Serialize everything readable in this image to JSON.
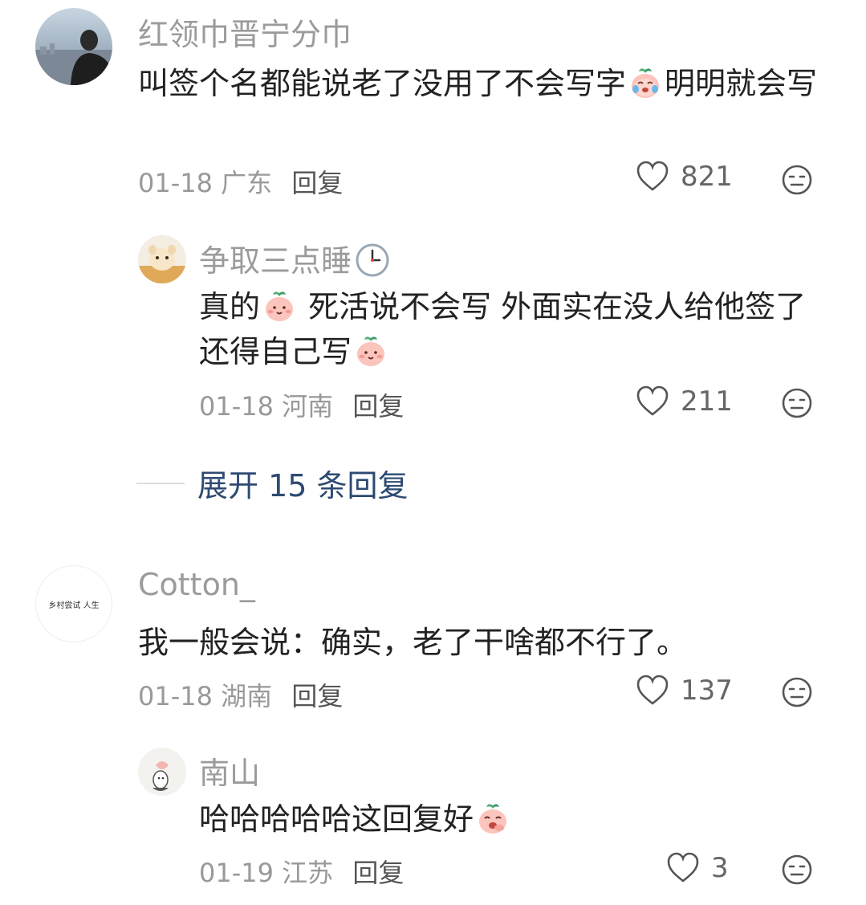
{
  "comments": [
    {
      "username": "红领巾晋宁分巾",
      "text_parts": [
        "叫签个名都能说老了没用了不会写字",
        "明明就会写"
      ],
      "date": "01-18",
      "location": "广东",
      "reply_label": "回复",
      "likes": "821",
      "replies": [
        {
          "username": "争取三点睡",
          "text_parts": [
            "真的",
            " 死活说不会写 外面实在没人给他签了还得自己写",
            ""
          ],
          "date": "01-18",
          "location": "河南",
          "reply_label": "回复",
          "likes": "211"
        }
      ],
      "expand_label": "展开 15 条回复"
    },
    {
      "username": "Cotton_",
      "avatar_text": "乡村尝试 人生",
      "text": "我一般会说：确实，老了干啥都不行了。",
      "date": "01-18",
      "location": "湖南",
      "reply_label": "回复",
      "likes": "137",
      "replies": [
        {
          "username": "南山",
          "text_parts": [
            "哈哈哈哈哈这回复好",
            ""
          ],
          "date": "01-19",
          "location": "江苏",
          "reply_label": "回复",
          "likes": "3"
        }
      ]
    }
  ],
  "icons": {
    "like": "heart-outline-icon",
    "react": "neutral-face-icon",
    "clock": "clock-icon"
  },
  "colors": {
    "username": "#9b9b9b",
    "link": "#2d4a72",
    "meta": "#999999"
  }
}
